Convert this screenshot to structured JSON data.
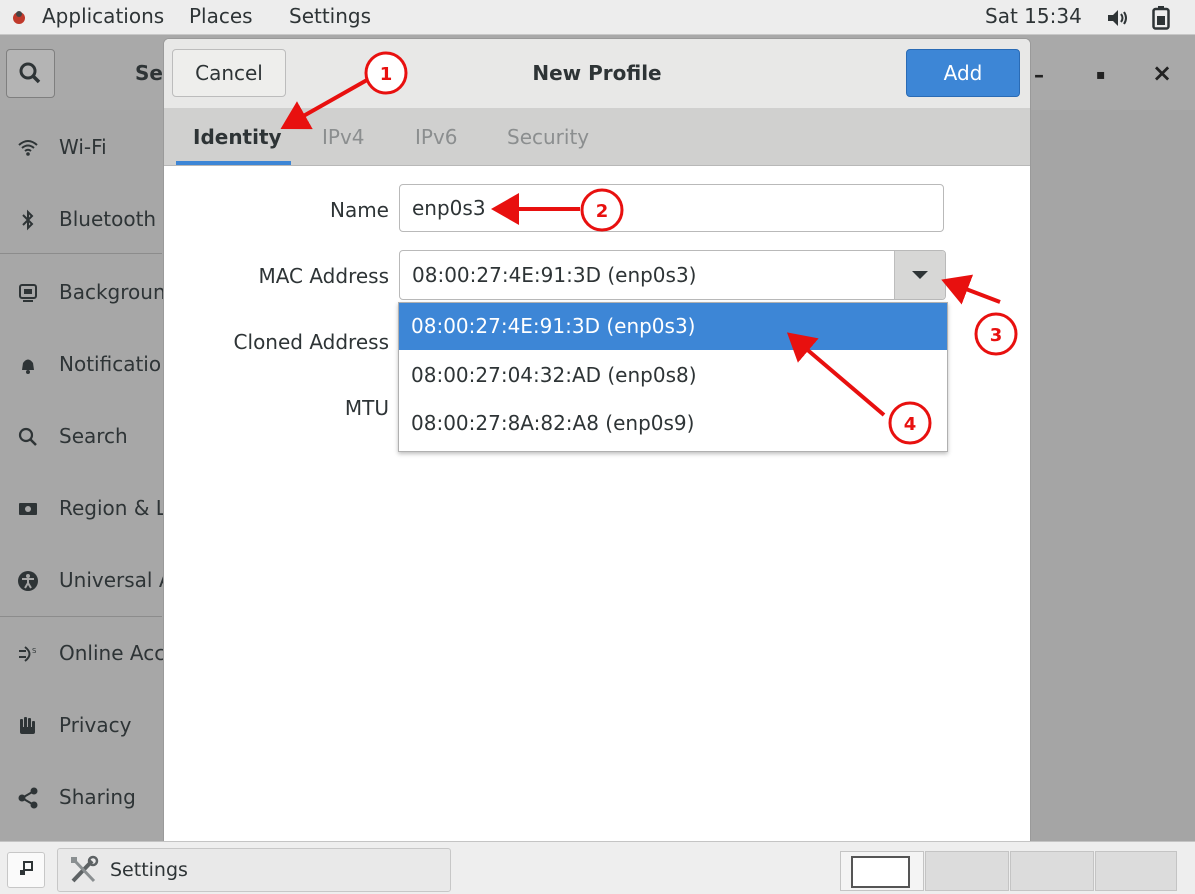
{
  "topbar": {
    "applications": "Applications",
    "places": "Places",
    "settings": "Settings",
    "clock": "Sat 15:34"
  },
  "background_window": {
    "title": "Se",
    "minimize": "–",
    "maximize": "▪",
    "close": "×",
    "sidebar": [
      {
        "label": "Wi-Fi",
        "icon": "wifi-icon"
      },
      {
        "label": "Bluetooth",
        "icon": "bluetooth-icon"
      },
      {
        "label": "Backgroun",
        "icon": "background-icon"
      },
      {
        "label": "Notificatio",
        "icon": "bell-icon"
      },
      {
        "label": "Search",
        "icon": "search-icon"
      },
      {
        "label": "Region & L",
        "icon": "region-icon"
      },
      {
        "label": "Universal A",
        "icon": "accessibility-icon"
      },
      {
        "label": "Online Acc",
        "icon": "online-accounts-icon"
      },
      {
        "label": "Privacy",
        "icon": "privacy-hand-icon"
      },
      {
        "label": "Sharing",
        "icon": "share-icon"
      }
    ]
  },
  "dialog": {
    "cancel": "Cancel",
    "title": "New Profile",
    "add": "Add",
    "tabs": [
      "Identity",
      "IPv4",
      "IPv6",
      "Security"
    ],
    "active_tab": "Identity",
    "labels": {
      "name": "Name",
      "mac": "MAC Address",
      "cloned": "Cloned Address",
      "mtu": "MTU"
    },
    "name_value": "enp0s3",
    "mac_value": "08:00:27:4E:91:3D (enp0s3)",
    "mac_options": [
      "08:00:27:4E:91:3D (enp0s3)",
      "08:00:27:04:32:AD (enp0s8)",
      "08:00:27:8A:82:A8 (enp0s9)"
    ],
    "selected_option_index": 0
  },
  "annotations": [
    "1",
    "2",
    "3",
    "4"
  ],
  "taskbar": {
    "settings_label": "Settings"
  },
  "colors": {
    "accent": "#3d86d6",
    "annotation": "#e8100f"
  }
}
